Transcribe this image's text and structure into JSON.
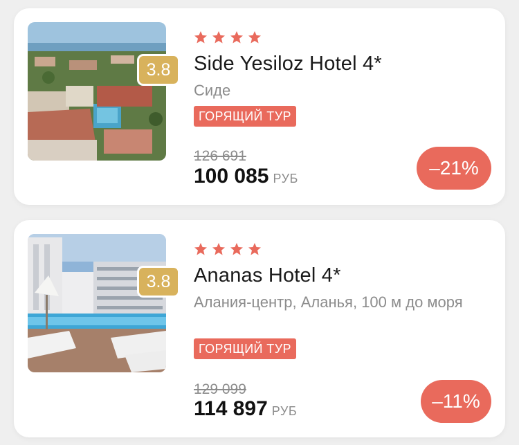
{
  "cards": [
    {
      "rating": "3.8",
      "stars": 4,
      "name": "Side Yesiloz Hotel 4*",
      "location": "Сиде",
      "badge": "ГОРЯЩИЙ ТУР",
      "old_price": "126 691",
      "price": "100 085",
      "currency": "РУБ",
      "discount": "–21%"
    },
    {
      "rating": "3.8",
      "stars": 4,
      "name": "Ananas Hotel 4*",
      "location": "Алания-центр, Аланья, 100 м до моря",
      "badge": "ГОРЯЩИЙ ТУР",
      "old_price": "129 099",
      "price": "114 897",
      "currency": "РУБ",
      "discount": "–11%"
    }
  ],
  "colors": {
    "accent": "#e96a5c",
    "rating_badge": "#d8b25c",
    "background": "#efefef"
  }
}
